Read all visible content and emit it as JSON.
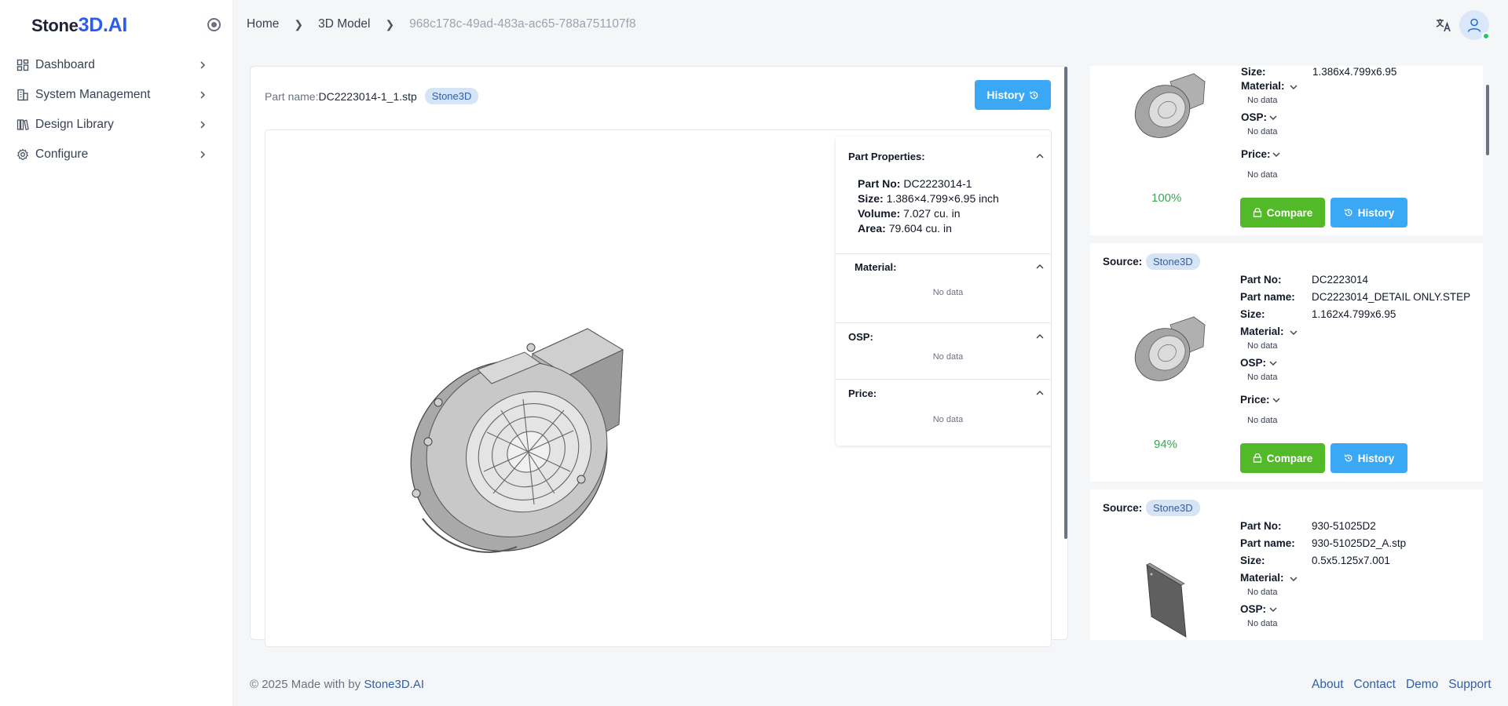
{
  "brand": {
    "logo_prefix": "Stone",
    "logo_big": "3D",
    "logo_suffix": ".AI"
  },
  "sidebar": {
    "items": [
      {
        "label": "Dashboard",
        "icon": "dashboard-icon"
      },
      {
        "label": "System Management",
        "icon": "building-icon"
      },
      {
        "label": "Design Library",
        "icon": "library-icon"
      },
      {
        "label": "Configure",
        "icon": "gear-icon"
      }
    ]
  },
  "breadcrumb": {
    "home": "Home",
    "section": "3D Model",
    "current": "968c178c-49ad-483a-ac65-788a751107f8"
  },
  "main": {
    "part_name_label": "Part name:",
    "part_name_value": "DC2223014-1_1.stp",
    "source_badge": "Stone3D",
    "history_button": "History"
  },
  "properties": {
    "title": "Part Properties:",
    "part_no_label": "Part No:",
    "part_no": "DC2223014-1",
    "size_label": "Size:",
    "size": "1.386×4.799×6.95 inch",
    "volume_label": "Volume:",
    "volume": "7.027 cu. in",
    "area_label": "Area:",
    "area": "79.604 cu. in",
    "material_title": "Material:",
    "osp_title": "OSP:",
    "price_title": "Price:",
    "no_data": "No data"
  },
  "results": {
    "labels": {
      "source": "Source:",
      "part_no": "Part No:",
      "part_name": "Part name:",
      "size": "Size:",
      "material": "Material:",
      "osp": "OSP:",
      "price": "Price:",
      "no_data": "No data",
      "compare": "Compare",
      "history": "History"
    },
    "items": [
      {
        "size": "1.386x4.799x6.95",
        "percent": "100%"
      },
      {
        "source": "Stone3D",
        "part_no": "DC2223014",
        "part_name": "DC2223014_DETAIL ONLY.STEP",
        "size": "1.162x4.799x6.95",
        "percent": "94%"
      },
      {
        "source": "Stone3D",
        "part_no": "930-51025D2",
        "part_name": "930-51025D2_A.stp",
        "size": "0.5x5.125x7.001"
      }
    ]
  },
  "footer": {
    "copyright": "© 2025 Made with by ",
    "brand_link": "Stone3D.AI",
    "links": [
      "About",
      "Contact",
      "Demo",
      "Support"
    ]
  },
  "colors": {
    "primary_blue": "#3ba8f5",
    "compare_green": "#52b928",
    "brand_blue": "#2a5cf0",
    "percent_green": "#3aa853"
  }
}
